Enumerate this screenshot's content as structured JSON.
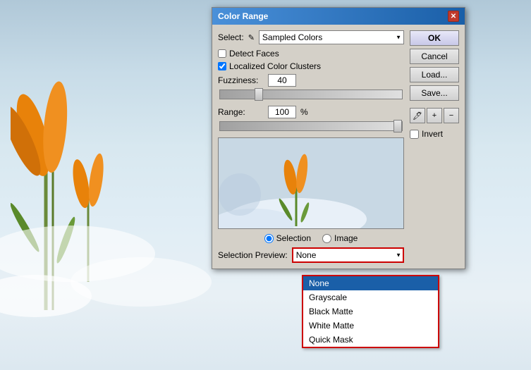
{
  "background": {
    "description": "Crocus flower in snow photo"
  },
  "dialog": {
    "title": "Color Range",
    "close_btn": "✕",
    "select_label": "Select:",
    "select_icon": "✎",
    "select_value": "Sampled Colors",
    "detect_faces_label": "Detect Faces",
    "localized_color_clusters_label": "Localized Color Clusters",
    "fuzziness_label": "Fuzziness:",
    "fuzziness_value": "40",
    "range_label": "Range:",
    "range_value": "100",
    "range_percent": "%",
    "radio_selection": "Selection",
    "radio_image": "Image",
    "selection_preview_label": "Selection Preview:",
    "preview_value": "None",
    "ok_label": "OK",
    "cancel_label": "Cancel",
    "load_label": "Load...",
    "save_label": "Save...",
    "invert_label": "Invert",
    "tool1": "✎",
    "tool2": "✎",
    "tool3": "✎"
  },
  "dropdown_menu": {
    "items": [
      {
        "label": "None",
        "selected": true
      },
      {
        "label": "Grayscale",
        "selected": false
      },
      {
        "label": "Black Matte",
        "selected": false
      },
      {
        "label": "White Matte",
        "selected": false
      },
      {
        "label": "Quick Mask",
        "selected": false
      }
    ]
  }
}
